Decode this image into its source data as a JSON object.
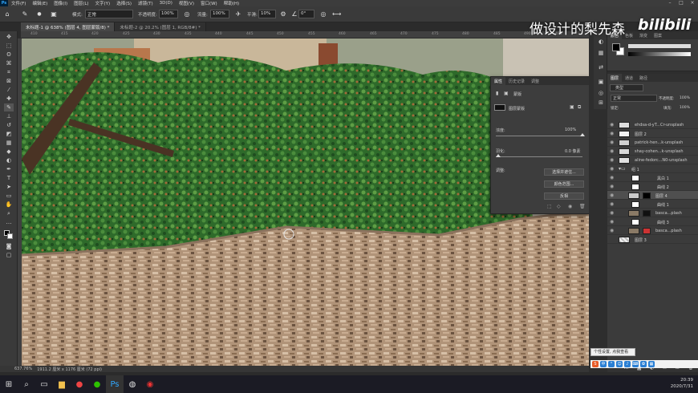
{
  "menubar": {
    "app": "Ps",
    "items": [
      "文件(F)",
      "编辑(E)",
      "图像(I)",
      "图层(L)",
      "文字(Y)",
      "选择(S)",
      "滤镜(T)",
      "3D(D)",
      "视图(V)",
      "窗口(W)",
      "帮助(H)"
    ]
  },
  "options": {
    "mode_label": "模式:",
    "mode_value": "正常",
    "opacity_label": "不透明度:",
    "opacity_value": "100%",
    "flow_label": "流量:",
    "flow_value": "100%",
    "smooth_label": "平滑:",
    "smooth_value": "10%",
    "angle_value": "0°"
  },
  "tabs": [
    {
      "label": "未标题-1 @ 638% (图层 4, 图层蒙版/8) *",
      "active": true
    },
    {
      "label": "未标题-2 @ 20.2% (图层 1, RGB/8#) *",
      "active": false
    }
  ],
  "ruler": {
    "ticks": [
      "410",
      "415",
      "420",
      "425",
      "430",
      "435",
      "440",
      "445",
      "450",
      "455",
      "460",
      "465",
      "470",
      "475",
      "480",
      "485",
      "490",
      "495"
    ]
  },
  "status": {
    "zoom": "637.76%",
    "docinfo": "1911.2 厘米 x 1176 厘米 (72 ppi)"
  },
  "properties": {
    "tabs": [
      "属性",
      "历史记录",
      "调整"
    ],
    "title": "蒙版",
    "sub": "图层蒙版",
    "density_label": "浓度:",
    "density_value": "100%",
    "feather_label": "羽化:",
    "feather_value": "0.0 像素",
    "refine_label": "调整:",
    "select_mask": "选择并遮住...",
    "color_range": "颜色范围...",
    "invert": "反相",
    "density_level": 1.0,
    "feather_level": 0.0
  },
  "colorpanel": {
    "tabs": [
      "颜色",
      "色板",
      "渐变",
      "图案"
    ],
    "fg": "#000000",
    "bg": "#ffffff"
  },
  "layers": {
    "tabs": [
      "图层",
      "通道",
      "路径"
    ],
    "kind_label": "类型",
    "blend": "正常",
    "opacity_label": "不透明度:",
    "opacity_value": "100%",
    "lock_label": "锁定:",
    "fill_label": "填充:",
    "fill_value": "100%",
    "items": [
      {
        "name": "ehdsa-d-yT...Cr-unsplash",
        "selected": false
      },
      {
        "name": "图层 2",
        "selected": false
      },
      {
        "name": "patrick-hen...k-unsplash",
        "selected": false
      },
      {
        "name": "shay-cohen...k-unsplash",
        "selected": false
      },
      {
        "name": "aline-fedorc...N0-unsplash",
        "selected": false
      },
      {
        "name": "组 1",
        "selected": false
      },
      {
        "name": "黑白 1",
        "selected": false
      },
      {
        "name": "曲线 2",
        "selected": false
      },
      {
        "name": "图层 4",
        "selected": true
      },
      {
        "name": "曲线 1",
        "selected": false
      },
      {
        "name": "basca...plash",
        "selected": false
      },
      {
        "name": "曲线 3",
        "selected": false
      },
      {
        "name": "basca...plash",
        "selected": false
      },
      {
        "name": "图层 3",
        "selected": false
      }
    ]
  },
  "tooltip": "个性设置, 点我查看",
  "clock": {
    "time": "20:39",
    "date": "2020/7/31"
  },
  "watermark": "做设计的梨先森",
  "bilibili": "bilibili"
}
